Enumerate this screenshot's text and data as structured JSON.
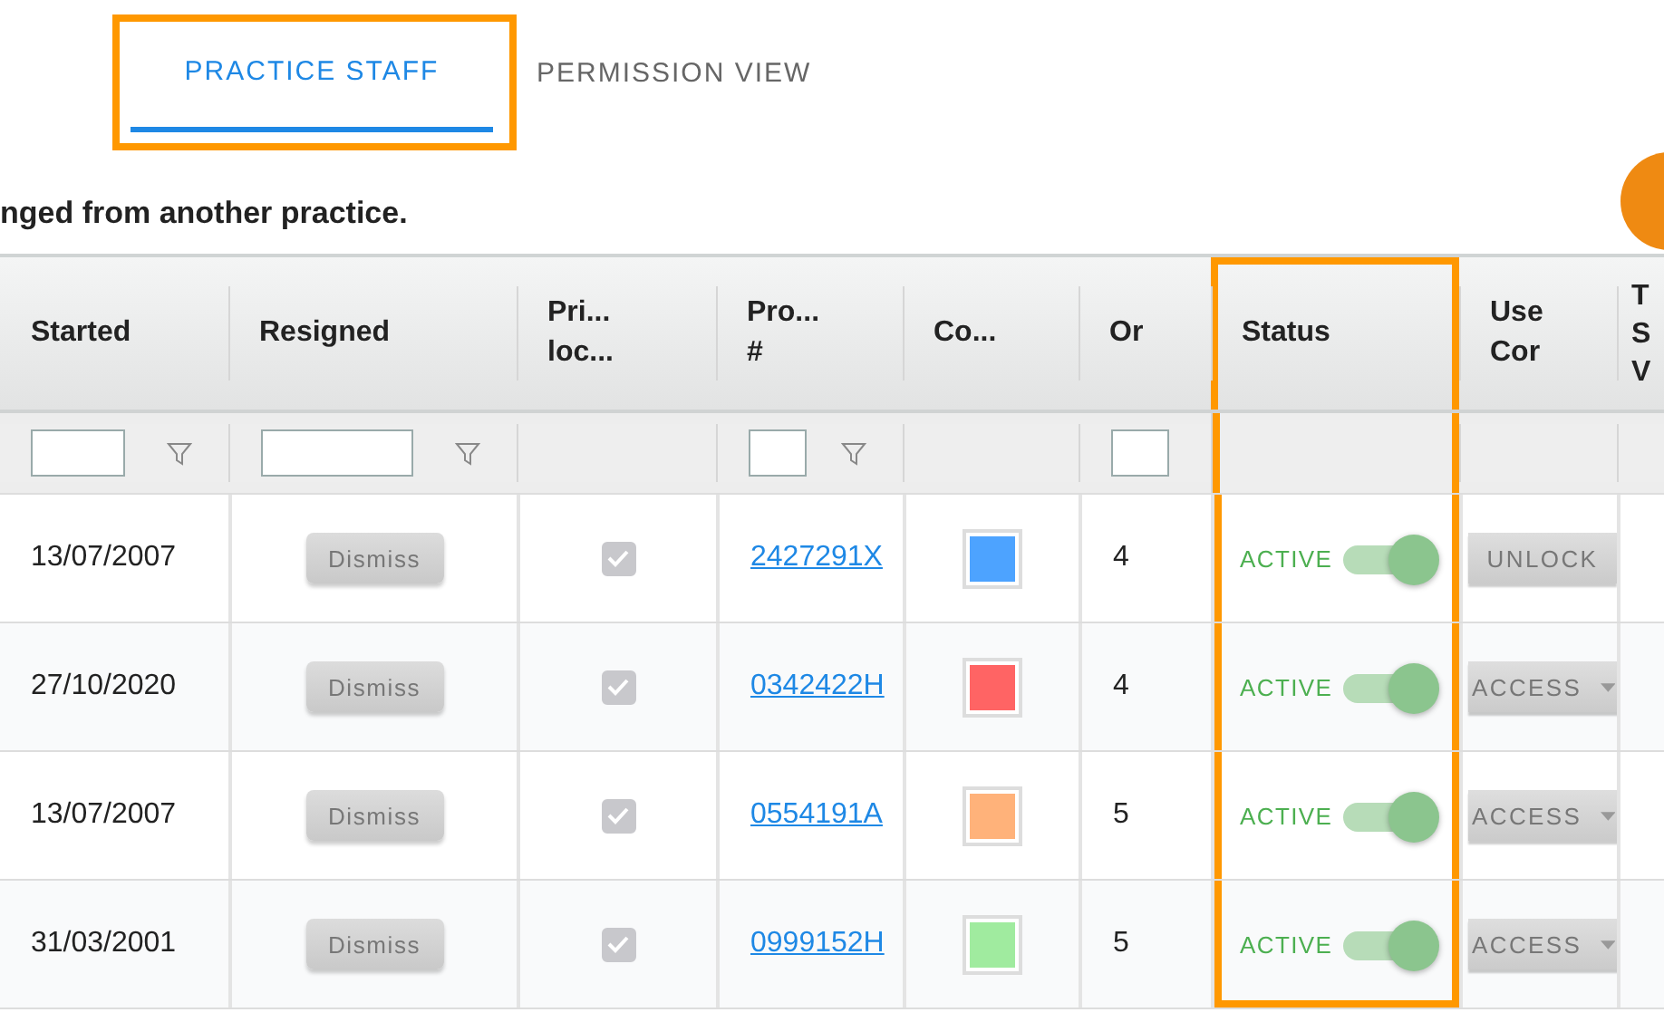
{
  "tabs": [
    {
      "label": "PRACTICE STAFF",
      "selected": true,
      "highlighted": true
    },
    {
      "label": "PERMISSION VIEW",
      "selected": false,
      "highlighted": false
    }
  ],
  "notice": "nged from another practice.",
  "table": {
    "columns": [
      {
        "label": "Started",
        "filter_field": true,
        "filter_icon": true,
        "highlighted": false
      },
      {
        "label": "Resigned",
        "filter_field": true,
        "filter_icon": true,
        "highlighted": false
      },
      {
        "label": "Pri...\nloc...",
        "filter_field": false,
        "filter_icon": false,
        "highlighted": false
      },
      {
        "label": "Pro...\n#",
        "filter_field": true,
        "filter_icon": true,
        "highlighted": false
      },
      {
        "label": "Co...",
        "filter_field": false,
        "filter_icon": false,
        "highlighted": false
      },
      {
        "label": "Or",
        "filter_field": true,
        "filter_icon": false,
        "highlighted": false
      },
      {
        "label": "Status",
        "filter_field": false,
        "filter_icon": false,
        "highlighted": true
      },
      {
        "label": "Use\nCor",
        "filter_field": false,
        "filter_icon": false,
        "highlighted": false
      },
      {
        "label": "T\nS\nV",
        "filter_field": false,
        "filter_icon": false,
        "highlighted": false
      }
    ],
    "rows": [
      {
        "started": "13/07/2007",
        "dismiss": "Dismiss",
        "checked": true,
        "number": "2427291X",
        "color": "#4da3ff",
        "order": "4",
        "status": "ACTIVE",
        "on": true,
        "action": {
          "kind": "unlock",
          "label": "UNLOCK"
        }
      },
      {
        "started": "27/10/2020",
        "dismiss": "Dismiss",
        "checked": true,
        "number": "0342422H",
        "color": "#ff6464",
        "order": "4",
        "status": "ACTIVE",
        "on": true,
        "action": {
          "kind": "dropdown",
          "label": "ACCESS"
        }
      },
      {
        "started": "13/07/2007",
        "dismiss": "Dismiss",
        "checked": true,
        "number": "0554191A",
        "color": "#ffb27a",
        "order": "5",
        "status": "ACTIVE",
        "on": true,
        "action": {
          "kind": "dropdown",
          "label": "ACCESS"
        }
      },
      {
        "started": "31/03/2001",
        "dismiss": "Dismiss",
        "checked": true,
        "number": "0999152H",
        "color": "#a0eb9f",
        "order": "5",
        "status": "ACTIVE",
        "on": true,
        "action": {
          "kind": "dropdown",
          "label": "ACCESS"
        }
      }
    ]
  }
}
